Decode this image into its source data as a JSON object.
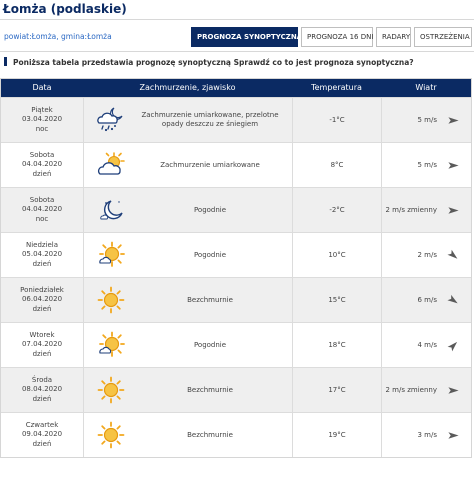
{
  "location": {
    "title": "Łomża (podlaskie)"
  },
  "breadcrumb": {
    "text": "powiat:Łomża, gmina:Łomża"
  },
  "tabs": [
    {
      "label": "PROGNOZA SYNOPTYCZNA",
      "active": true
    },
    {
      "label": "PROGNOZA 16 DNI",
      "active": false
    },
    {
      "label": "RADARY",
      "active": false
    },
    {
      "label": "OSTRZEŻENIA",
      "active": false
    }
  ],
  "info": {
    "text": "Poniższa tabela przedstawia prognozę synoptyczną Sprawdź co to jest prognoza synoptyczna?"
  },
  "table": {
    "headers": [
      "Data",
      "Zachmurzenie, zjawisko",
      "Temperatura",
      "Wiatr"
    ],
    "rows": [
      {
        "day": "Piątek",
        "date": "03.04.2020",
        "time": "noc",
        "icon": "cloud-moon-rain-snow-icon",
        "desc": "Zachmurzenie umiarkowane, przelotne opady deszczu ze śniegiem",
        "temp": "-1°C",
        "wind": "5 m/s",
        "wind_dir_deg": 90
      },
      {
        "day": "Sobota",
        "date": "04.04.2020",
        "time": "dzień",
        "icon": "sun-cloud-icon",
        "desc": "Zachmurzenie umiarkowane",
        "temp": "8°C",
        "wind": "5 m/s",
        "wind_dir_deg": 90
      },
      {
        "day": "Sobota",
        "date": "04.04.2020",
        "time": "noc",
        "icon": "moon-icon",
        "desc": "Pogodnie",
        "temp": "-2°C",
        "wind": "2 m/s zmienny",
        "wind_dir_deg": 90
      },
      {
        "day": "Niedziela",
        "date": "05.04.2020",
        "time": "dzień",
        "icon": "sun-small-cloud-icon",
        "desc": "Pogodnie",
        "temp": "10°C",
        "wind": "2 m/s",
        "wind_dir_deg": 130
      },
      {
        "day": "Poniedziałek",
        "date": "06.04.2020",
        "time": "dzień",
        "icon": "sun-icon",
        "desc": "Bezchmurnie",
        "temp": "15°C",
        "wind": "6 m/s",
        "wind_dir_deg": 125
      },
      {
        "day": "Wtorek",
        "date": "07.04.2020",
        "time": "dzień",
        "icon": "sun-small-cloud-icon",
        "desc": "Pogodnie",
        "temp": "18°C",
        "wind": "4 m/s",
        "wind_dir_deg": 45
      },
      {
        "day": "Środa",
        "date": "08.04.2020",
        "time": "dzień",
        "icon": "sun-icon",
        "desc": "Bezchmurnie",
        "temp": "17°C",
        "wind": "2 m/s zmienny",
        "wind_dir_deg": 90
      },
      {
        "day": "Czwartek",
        "date": "09.04.2020",
        "time": "dzień",
        "icon": "sun-icon",
        "desc": "Bezchmurnie",
        "temp": "19°C",
        "wind": "3 m/s",
        "wind_dir_deg": 90
      }
    ]
  },
  "colors": {
    "navy": "#0b2a63",
    "link": "#2b69c4",
    "sun": "#f2a81d",
    "cloud": "#1f3f7a"
  }
}
